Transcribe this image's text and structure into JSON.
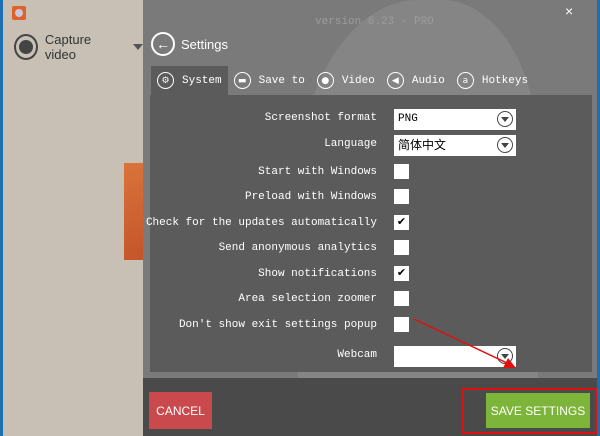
{
  "sidebar": {
    "capture_label": "Capture video"
  },
  "header": {
    "version": "version 6.23 - PRO",
    "back_label": "Settings",
    "close": "×"
  },
  "tabs": [
    {
      "label": "System",
      "icon": "gears-icon"
    },
    {
      "label": "Save to",
      "icon": "folder-icon"
    },
    {
      "label": "Video",
      "icon": "record-icon"
    },
    {
      "label": "Audio",
      "icon": "speaker-icon"
    },
    {
      "label": "Hotkeys",
      "icon": "key-icon"
    }
  ],
  "settings": {
    "screenshot_format": {
      "label": "Screenshot format",
      "value": "PNG"
    },
    "language": {
      "label": "Language",
      "value": "简体中文"
    },
    "webcam": {
      "label": "Webcam",
      "value": ""
    },
    "checks": [
      {
        "label": "Start with Windows",
        "checked": false
      },
      {
        "label": "Preload with Windows",
        "checked": false
      },
      {
        "label": "Check for the updates automatically",
        "checked": true
      },
      {
        "label": "Send anonymous analytics",
        "checked": false
      },
      {
        "label": "Show notifications",
        "checked": true
      },
      {
        "label": "Area selection zoomer",
        "checked": false
      },
      {
        "label": "Don't show exit settings popup",
        "checked": false
      }
    ]
  },
  "footer": {
    "cancel": "CANCEL",
    "save": "SAVE SETTINGS"
  },
  "colors": {
    "cancel": "#c9494d",
    "save": "#7cb53a",
    "highlight": "#e01010"
  }
}
